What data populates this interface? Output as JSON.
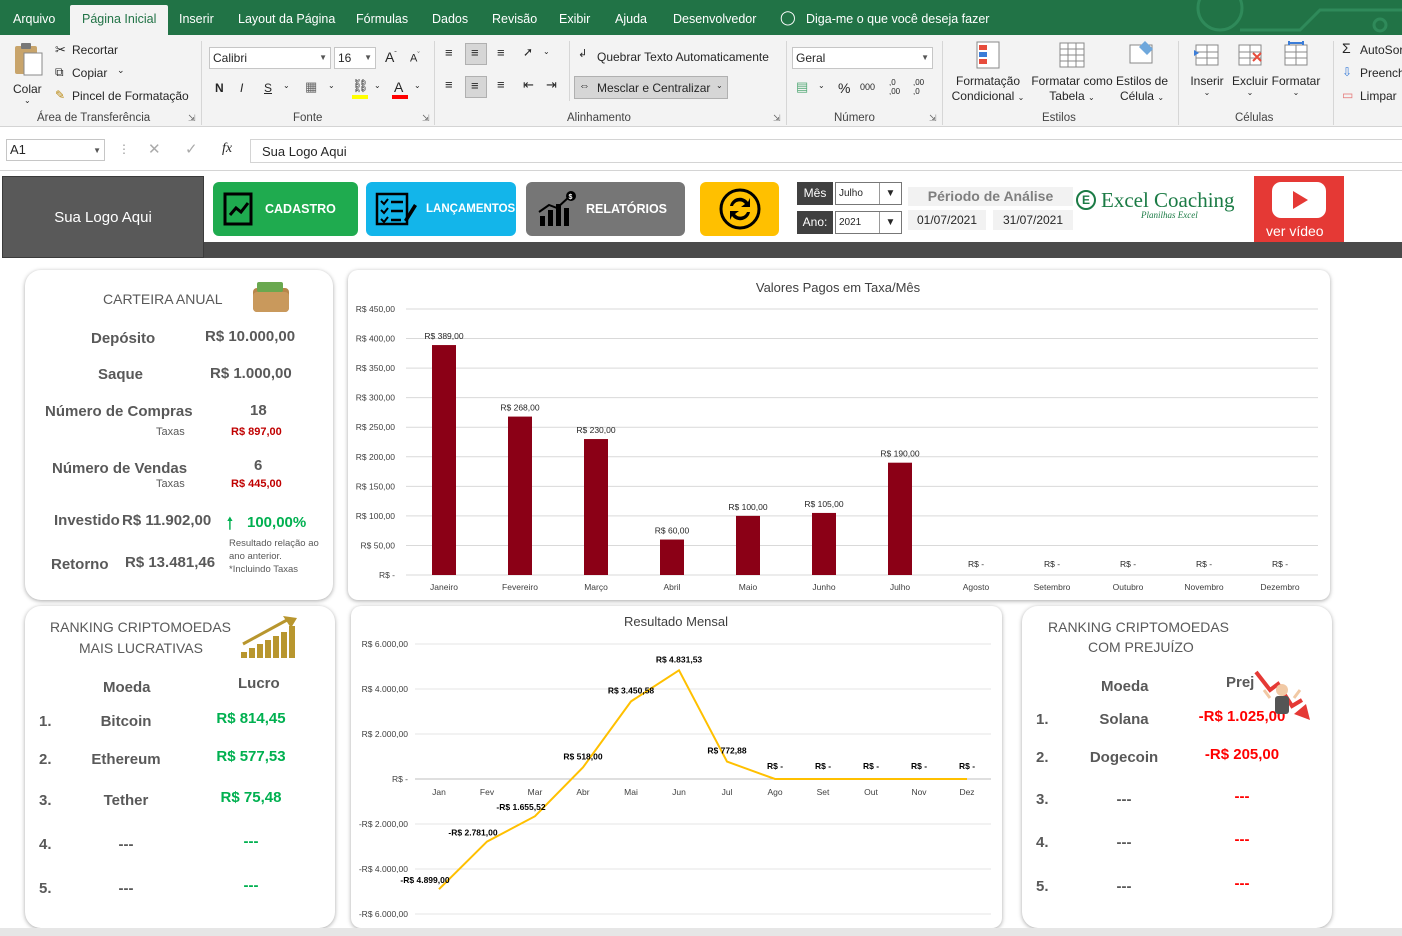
{
  "ribbon_tabs": [
    "Arquivo",
    "Página Inicial",
    "Inserir",
    "Layout da Página",
    "Fórmulas",
    "Dados",
    "Revisão",
    "Exibir",
    "Ajuda",
    "Desenvolvedor"
  ],
  "tell_me": "Diga-me o que você deseja fazer",
  "clipboard": {
    "paste": "Colar",
    "cut": "Recortar",
    "copy": "Copiar",
    "format_painter": "Pincel de Formatação",
    "label": "Área de Transferência"
  },
  "font": {
    "name": "Calibri",
    "size": "16",
    "bold": "N",
    "italic": "I",
    "underline": "S",
    "grow": "A",
    "shrink": "A",
    "color_letter": "A",
    "label": "Fonte"
  },
  "alignment": {
    "wrap": "Quebrar Texto Automaticamente",
    "merge": "Mesclar e Centralizar",
    "label": "Alinhamento"
  },
  "number": {
    "format": "Geral",
    "percent": "%",
    "thousands": "000",
    "inc_decimal": ",0\n,00",
    "dec_decimal": ",00\n,0",
    "label": "Número"
  },
  "styles": {
    "cond1": "Formatação",
    "cond2": "Condicional",
    "table1": "Formatar como",
    "table2": "Tabela",
    "cell1": "Estilos de",
    "cell2": "Célula",
    "label": "Estilos"
  },
  "cells": {
    "insert": "Inserir",
    "delete": "Excluir",
    "format": "Formatar",
    "label": "Células"
  },
  "editing": {
    "autosum": "AutoSor",
    "fill": "Preench",
    "clear": "Limpar"
  },
  "formula_bar": {
    "name_box": "A1",
    "fx": "fx",
    "content": "Sua Logo Aqui"
  },
  "header": {
    "logo": "Sua Logo Aqui",
    "nav": [
      "CADASTRO",
      "LANÇAMENTOS",
      "RELATÓRIOS"
    ],
    "mes_label": "Mês",
    "mes_value": "Julho",
    "ano_label": "Ano:",
    "ano_value": "2021",
    "periodo_title": "Périodo de Análise",
    "periodo_start": "01/07/2021",
    "periodo_end": "31/07/2021",
    "brand": "Excel Coaching",
    "brand_sub": "Planilhas Excel",
    "video": "ver vídeo"
  },
  "carteira": {
    "title": "CARTEIRA ANUAL",
    "deposito_label": "Depósito",
    "deposito": "R$ 10.000,00",
    "saque_label": "Saque",
    "saque": "R$ 1.000,00",
    "compras_label": "Número de Compras",
    "compras": "18",
    "compras_taxas_label": "Taxas",
    "compras_taxas": "R$ 897,00",
    "vendas_label": "Número de Vendas",
    "vendas": "6",
    "vendas_taxas_label": "Taxas",
    "vendas_taxas": "R$ 445,00",
    "investido_label": "Investido",
    "investido": "R$ 11.902,00",
    "pct": "100,00%",
    "pct_note1": "Resultado relação ao",
    "pct_note2": "ano anterior.",
    "pct_note3": "*Incluindo Taxas",
    "retorno_label": "Retorno",
    "retorno": "R$ 13.481,46"
  },
  "ranking_lucro": {
    "title1": "RANKING CRIPTOMOEDAS",
    "title2": "MAIS LUCRATIVAS",
    "col_moeda": "Moeda",
    "col_lucro": "Lucro",
    "rows": [
      {
        "n": "1.",
        "moeda": "Bitcoin",
        "valor": "R$ 814,45"
      },
      {
        "n": "2.",
        "moeda": "Ethereum",
        "valor": "R$ 577,53"
      },
      {
        "n": "3.",
        "moeda": "Tether",
        "valor": "R$ 75,48"
      },
      {
        "n": "4.",
        "moeda": "---",
        "valor": "---"
      },
      {
        "n": "5.",
        "moeda": "---",
        "valor": "---"
      }
    ]
  },
  "ranking_prejuizo": {
    "title1": "RANKING CRIPTOMOEDAS",
    "title2": "COM PREJUÍZO",
    "col_moeda": "Moeda",
    "col_prej": "Prej",
    "rows": [
      {
        "n": "1.",
        "moeda": "Solana",
        "valor": "-R$ 1.025,00"
      },
      {
        "n": "2.",
        "moeda": "Dogecoin",
        "valor": "-R$ 205,00"
      },
      {
        "n": "3.",
        "moeda": "---",
        "valor": "---"
      },
      {
        "n": "4.",
        "moeda": "---",
        "valor": "---"
      },
      {
        "n": "5.",
        "moeda": "---",
        "valor": "---"
      }
    ]
  },
  "colors": {
    "excel_green": "#217346",
    "bar": "#8b0016",
    "line": "#ffc000",
    "cadastro": "#1fab4f",
    "lancamentos": "#13b5ea",
    "relatorios": "#767676",
    "refresh": "#ffc000",
    "youtube": "#e53935"
  },
  "chart_data": [
    {
      "type": "bar",
      "title": "Valores Pagos em Taxa/Mês",
      "categories": [
        "Janeiro",
        "Fevereiro",
        "Março",
        "Abril",
        "Maio",
        "Junho",
        "Julho",
        "Agosto",
        "Setembro",
        "Outubro",
        "Novembro",
        "Dezembro"
      ],
      "values": [
        389,
        268,
        230,
        60,
        100,
        105,
        190,
        0,
        0,
        0,
        0,
        0
      ],
      "data_labels": [
        "R$ 389,00",
        "R$ 268,00",
        "R$ 230,00",
        "R$ 60,00",
        "R$ 100,00",
        "R$ 105,00",
        "R$ 190,00",
        "R$ -",
        "R$ -",
        "R$ -",
        "R$ -",
        "R$ -"
      ],
      "ylim": [
        0,
        450
      ],
      "yticks": [
        "R$ -",
        "R$ 50,00",
        "R$ 100,00",
        "R$ 150,00",
        "R$ 200,00",
        "R$ 250,00",
        "R$ 300,00",
        "R$ 350,00",
        "R$ 400,00",
        "R$ 450,00"
      ],
      "grid": true
    },
    {
      "type": "line",
      "title": "Resultado Mensal",
      "categories": [
        "Jan",
        "Fev",
        "Mar",
        "Abr",
        "Mai",
        "Jun",
        "Jul",
        "Ago",
        "Set",
        "Out",
        "Nov",
        "Dez"
      ],
      "values": [
        -4899,
        -2781,
        -1655.52,
        518,
        3450.58,
        4831.53,
        772.88,
        0,
        0,
        0,
        0,
        0
      ],
      "data_labels": [
        "-R$ 4.899,00",
        "-R$ 2.781,00",
        "-R$ 1.655,52",
        "R$ 518,00",
        "R$ 3.450,58",
        "R$ 4.831,53",
        "R$ 772,88",
        "R$ -",
        "R$ -",
        "R$ -",
        "R$ -",
        "R$ -"
      ],
      "ylim": [
        -6000,
        6000
      ],
      "yticks": [
        "-R$ 6.000,00",
        "-R$ 4.000,00",
        "-R$ 2.000,00",
        "R$ -",
        "R$ 2.000,00",
        "R$ 4.000,00",
        "R$ 6.000,00"
      ],
      "grid": true
    }
  ]
}
